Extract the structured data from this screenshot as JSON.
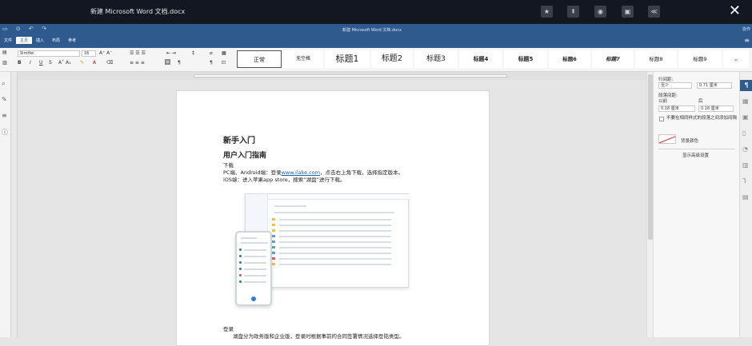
{
  "window": {
    "title": "新建 Microsoft Word 文档.docx",
    "icons": [
      "star-icon",
      "pin-icon",
      "record-icon",
      "save-icon",
      "collapse-icon"
    ],
    "icon_glyphs": [
      "★",
      "⇞",
      "◉",
      "▣",
      "≪"
    ],
    "close": "✕"
  },
  "ribbon": {
    "doc_title": "新建 Microsoft Word 文档.docx",
    "right_label": "协作",
    "tabs": [
      "文件",
      "主页",
      "插入",
      "布局",
      "参考"
    ],
    "active_tab": "主页",
    "font_name": "SimHei",
    "font_size": "16",
    "styles": [
      "正常",
      "无空格",
      "标题1",
      "标题2",
      "标题3",
      "标题4",
      "标题5",
      "标题6",
      "标题7",
      "标题8",
      "标题9"
    ]
  },
  "document": {
    "heading1": "新手入门",
    "heading2": "用户入门指南",
    "p_download": "下载",
    "p_pc_prefix": "PC端、Android端：登录",
    "p_pc_link": "www.ilake.com",
    "p_pc_suffix": "，点击右上角下载，选择指定版本。",
    "p_ios": "iOS端：进入苹果app store，搜索“湖盘”进行下载。",
    "p_login": "登录",
    "p_login_text": "湖盘分为政务版和企业版，登录时根据事前的合同签署情况选择登陆类型。"
  },
  "panel": {
    "line_spacing_label": "行间距:",
    "line_spacing_mode": "至少",
    "line_spacing_value": "0.71 厘米",
    "para_spacing_label": "段落间距:",
    "before_label": "以前",
    "after_label": "后",
    "before_value": "0.18 厘米",
    "after_value": "0.18 厘米",
    "checkbox_label": "不要在相同样式的段落之间添加间隔",
    "bg_color_label": "背景颜色",
    "advanced_label": "显示高级设置"
  }
}
